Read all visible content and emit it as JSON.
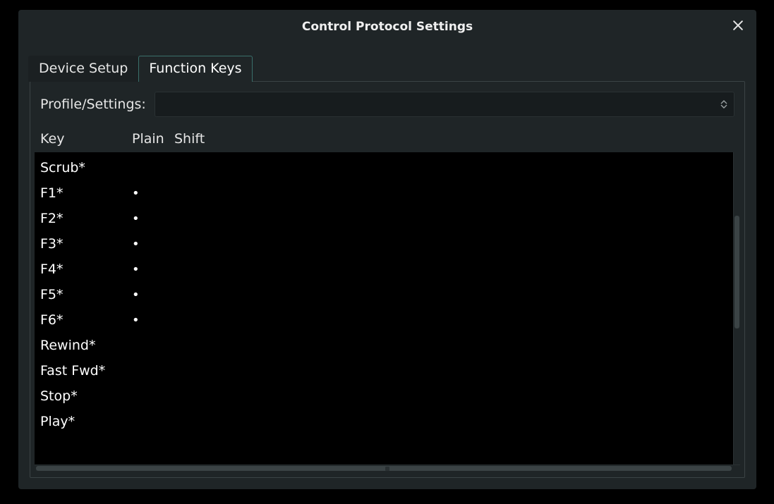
{
  "window": {
    "title": "Control Protocol Settings"
  },
  "tabs": [
    {
      "label": "Device Setup",
      "active": false
    },
    {
      "label": "Function Keys",
      "active": true
    }
  ],
  "profile": {
    "label": "Profile/Settings:",
    "value": ""
  },
  "columns": {
    "key": "Key",
    "plain": "Plain",
    "shift": "Shift"
  },
  "bullet": "•",
  "rows": [
    {
      "key": "Scrub*",
      "plain": "",
      "shift": ""
    },
    {
      "key": "F1*",
      "plain": "•",
      "shift": ""
    },
    {
      "key": "F2*",
      "plain": "•",
      "shift": ""
    },
    {
      "key": "F3*",
      "plain": "•",
      "shift": ""
    },
    {
      "key": "F4*",
      "plain": "•",
      "shift": ""
    },
    {
      "key": "F5*",
      "plain": "•",
      "shift": ""
    },
    {
      "key": "F6*",
      "plain": "•",
      "shift": ""
    },
    {
      "key": "Rewind*",
      "plain": "",
      "shift": ""
    },
    {
      "key": "Fast Fwd*",
      "plain": "",
      "shift": ""
    },
    {
      "key": "Stop*",
      "plain": "",
      "shift": ""
    },
    {
      "key": "Play*",
      "plain": "",
      "shift": ""
    }
  ]
}
